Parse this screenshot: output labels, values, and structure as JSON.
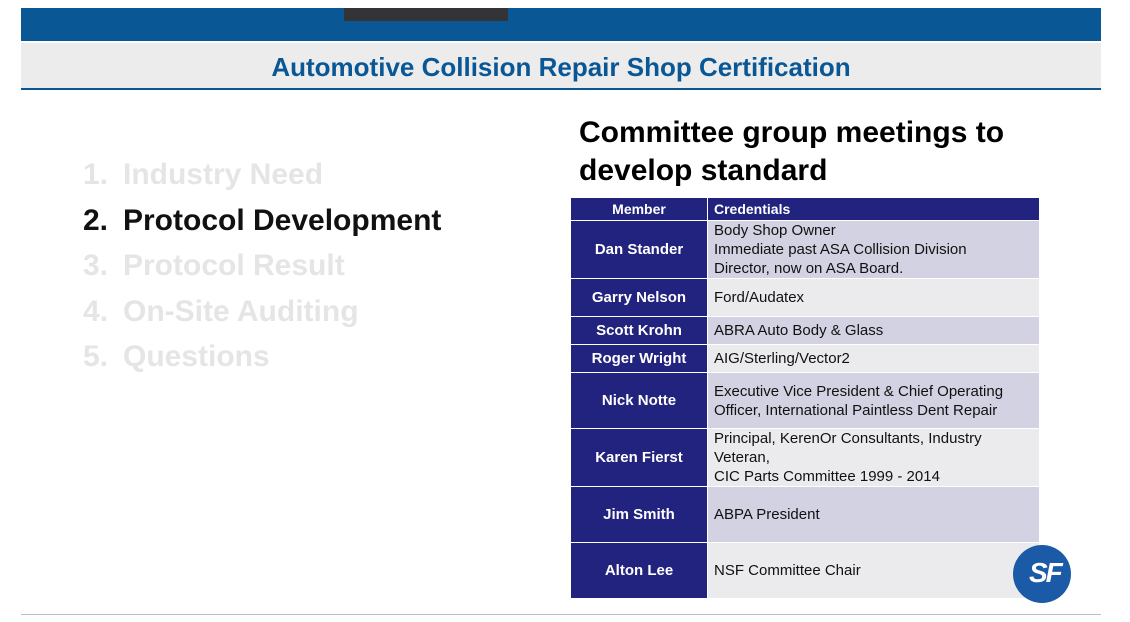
{
  "slide": {
    "title": "Automotive Collision Repair Shop Certification",
    "heading_line1": "Committee group meetings to",
    "heading_line2": "develop standard"
  },
  "agenda": [
    {
      "num": "1.",
      "label": "Industry Need",
      "active": false
    },
    {
      "num": "2.",
      "label": "Protocol Development",
      "active": true
    },
    {
      "num": "3.",
      "label": "Protocol Result",
      "active": false
    },
    {
      "num": "4.",
      "label": "On-Site Auditing",
      "active": false
    },
    {
      "num": "5.",
      "label": "Questions",
      "active": false
    }
  ],
  "table": {
    "headers": [
      "Member",
      "Credentials"
    ],
    "rows": [
      {
        "member": "Dan Stander",
        "lines": [
          "Body Shop Owner",
          "Immediate past ASA Collision Division",
          "Director, now on ASA Board."
        ]
      },
      {
        "member": "Garry Nelson",
        "lines": [
          "Ford/Audatex"
        ]
      },
      {
        "member": "Scott Krohn",
        "lines": [
          "ABRA Auto Body & Glass"
        ]
      },
      {
        "member": "Roger Wright",
        "lines": [
          "AIG/Sterling/Vector2"
        ]
      },
      {
        "member": "Nick Notte",
        "lines": [
          "Executive Vice President & Chief Operating",
          "Officer, International Paintless Dent Repair"
        ]
      },
      {
        "member": "Karen Fierst",
        "lines": [
          "Principal, KerenOr Consultants, Industry",
          "Veteran,",
          "CIC Parts Committee 1999 - 2014"
        ]
      },
      {
        "member": "Jim Smith",
        "lines": [
          "ABPA President"
        ]
      },
      {
        "member": "Alton Lee",
        "lines": [
          "NSF Committee Chair"
        ]
      }
    ]
  },
  "logo": {
    "text": "SF"
  },
  "colors": {
    "brand_blue": "#0a5796",
    "table_navy": "#22237e",
    "row_dark": "#d3d2e2",
    "row_light": "#ebebee"
  }
}
